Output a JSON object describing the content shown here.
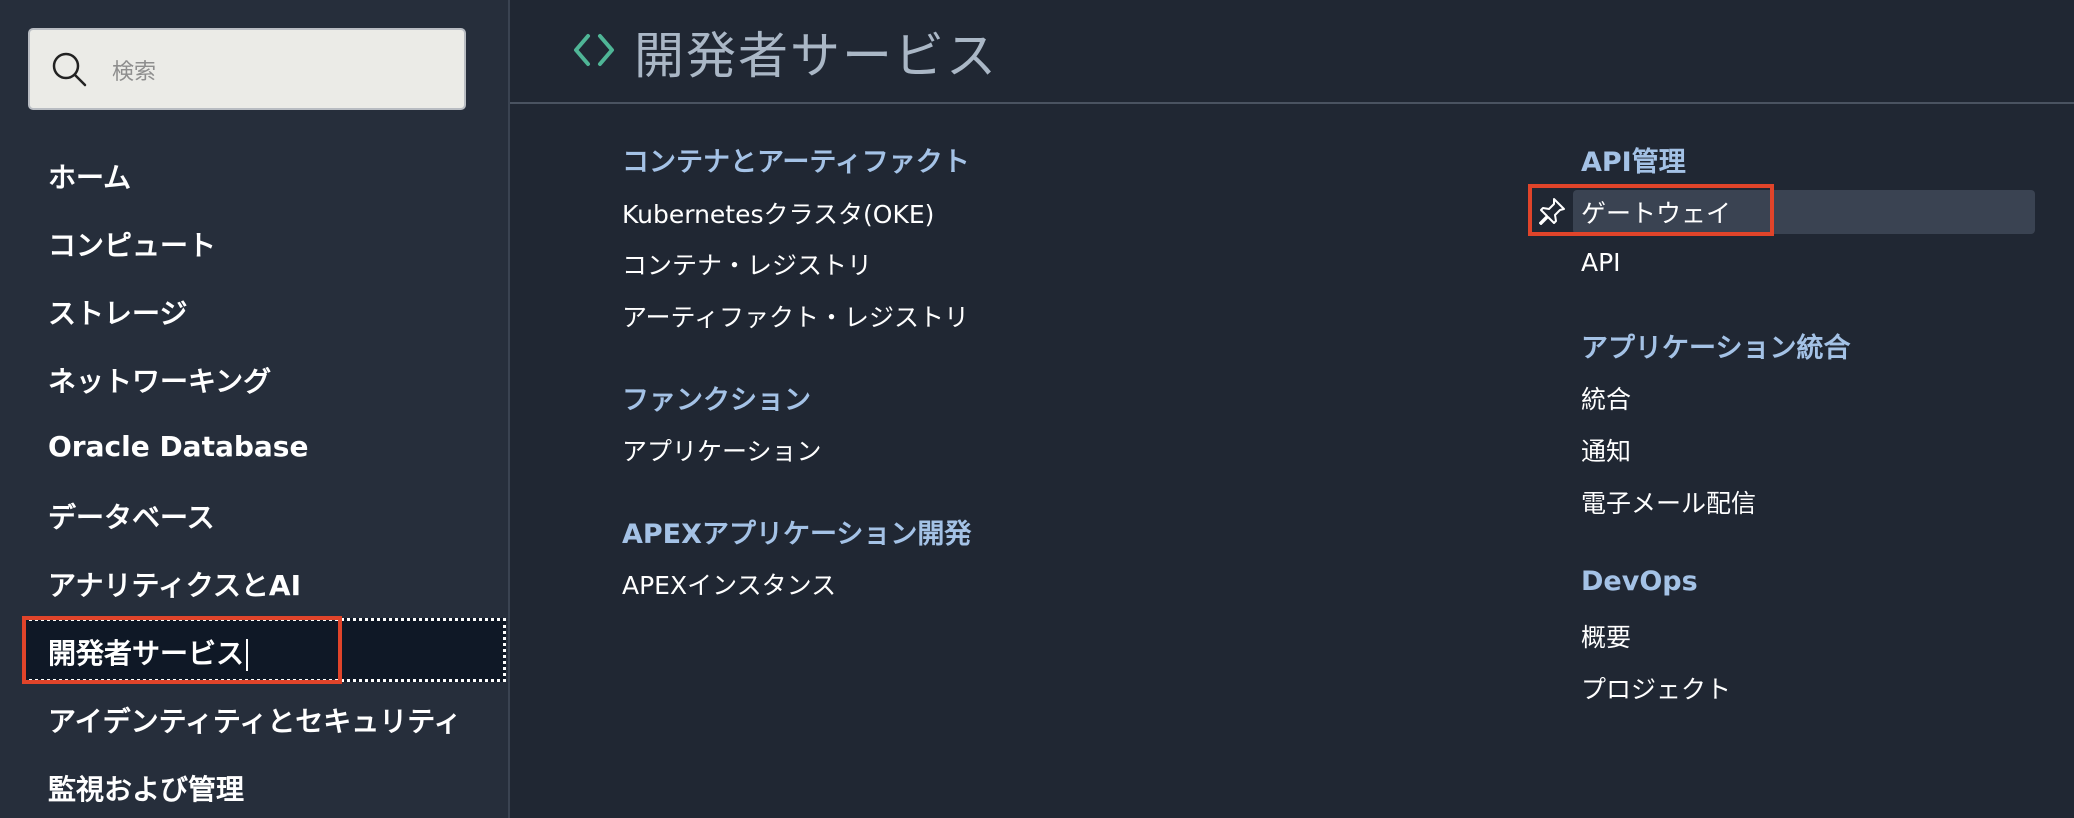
{
  "search": {
    "placeholder": "検索"
  },
  "sidebar": {
    "items": [
      {
        "label": "ホーム"
      },
      {
        "label": "コンピュート"
      },
      {
        "label": "ストレージ"
      },
      {
        "label": "ネットワーキング"
      },
      {
        "label": "Oracle Database"
      },
      {
        "label": "データベース"
      },
      {
        "label": "アナリティクスとAI"
      },
      {
        "label": "開発者サービス",
        "active": true
      },
      {
        "label": "アイデンティティとセキュリティ"
      },
      {
        "label": "監視および管理"
      }
    ]
  },
  "header": {
    "title": "開発者サービス",
    "icon": "code-brackets-icon",
    "icon_color": "#4fb596"
  },
  "columns": {
    "left": {
      "sections": [
        {
          "heading": "コンテナとアーティファクト",
          "links": [
            "Kubernetesクラスタ(OKE)",
            "コンテナ・レジストリ",
            "アーティファクト・レジストリ"
          ]
        },
        {
          "heading": "ファンクション",
          "links": [
            "アプリケーション"
          ]
        },
        {
          "heading": "APEXアプリケーション開発",
          "links": [
            "APEXインスタンス"
          ]
        }
      ]
    },
    "right": {
      "sections": [
        {
          "heading": "API管理",
          "links": [
            "ゲートウェイ",
            "API"
          ]
        },
        {
          "heading": "アプリケーション統合",
          "links": [
            "統合",
            "通知",
            "電子メール配信"
          ]
        },
        {
          "heading": "DevOps",
          "links": [
            "概要",
            "プロジェクト"
          ]
        }
      ]
    }
  },
  "colors": {
    "background": "#202733",
    "sidebar": "#262e3b",
    "heading": "#a4c2e6",
    "highlight": "#e0442a"
  }
}
